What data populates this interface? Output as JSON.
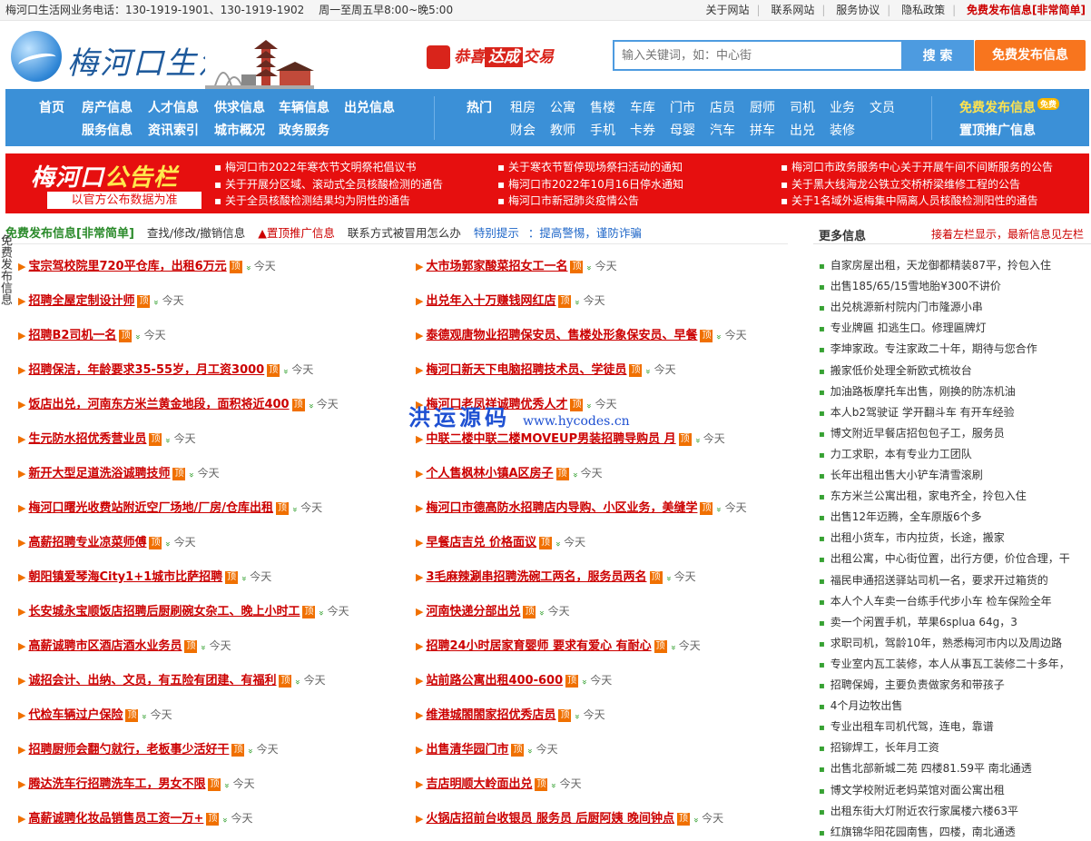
{
  "topbar": {
    "phone": "梅河口生活网业务电话：130-1919-1901、130-1919-1902",
    "hours": "周一至周五早8:00~晚5:00",
    "links": [
      "关于网站",
      "联系网站",
      "服务协议",
      "隐私政策"
    ],
    "free_publish": "免费发布信息[非常简单]"
  },
  "header": {
    "logo_text": "梅河口生活网",
    "promo_brand": "恭喜",
    "promo_box": "达成",
    "promo_tail": "交易",
    "search_placeholder": "输入关键词，如：中心街",
    "search_button": "搜 索",
    "publish_button": "免费发布信息"
  },
  "nav": {
    "main_row1": [
      "首页",
      "房产信息",
      "人才信息",
      "供求信息",
      "车辆信息",
      "出兑信息"
    ],
    "main_row2": [
      "服务信息",
      "资讯索引",
      "城市概况",
      "政务服务"
    ],
    "hot_label": "热门",
    "hot_row1": [
      "租房",
      "公寓",
      "售楼",
      "车库",
      "门市",
      "店员",
      "厨师",
      "司机",
      "业务",
      "文员"
    ],
    "hot_row2": [
      "财会",
      "教师",
      "手机",
      "卡券",
      "母婴",
      "汽车",
      "拼车",
      "出兑",
      "装修"
    ],
    "free_publish": "免费发布信息",
    "free_tag": "免费",
    "top_promo": "置顶推广信息"
  },
  "notice": {
    "title_big_a": "梅河口",
    "title_big_b": "公告栏",
    "title_small": "以官方公布数据为准",
    "col1": [
      "梅河口市2022年寒衣节文明祭祀倡议书",
      "关于开展分区域、滚动式全员核酸检测的通告",
      "关于全员核酸检测结果均为阴性的通告"
    ],
    "col2": [
      "关于寒衣节暂停现场祭扫活动的通知",
      "梅河口市2022年10月16日停水通知",
      "梅河口市新冠肺炎疫情公告"
    ],
    "col3": [
      "梅河口市政务服务中心关于开展午间不间断服务的公告",
      "关于黑大线海龙公铁立交桥桥梁维修工程的公告",
      "关于1名域外返梅集中隔离人员核酸检测阳性的通告"
    ]
  },
  "subbar": {
    "free": "免费发布信息[非常简单]",
    "manage": "查找/修改/撤销信息",
    "top": "▲置顶推广信息",
    "contact": "联系方式被冒用怎么办",
    "tip_label": "特别提示",
    "tip": "：提高警惕，谨防诈骗"
  },
  "side_deco": "免费发布信息",
  "listings": {
    "ding": "顶",
    "date": "今天",
    "left": [
      "宝宗驾校院里720平仓库，出租6万元",
      "招聘全屋定制设计师",
      "招聘B2司机一名",
      "招聘保洁，年龄要求35-55岁，月工资3000",
      "饭店出兑，河南东方米兰黄金地段，面积将近400",
      "生元防水招优秀营业员",
      "新开大型足道洗浴诚聘技师",
      "梅河口曙光收费站附近空厂场地/厂房/仓库出租",
      "高薪招聘专业凉菜师傅",
      "朝阳镇爱琴海City1+1城市比萨招聘",
      "长安城永宝顺饭店招聘后厨刷碗女杂工、晚上小时工",
      "高薪诚聘市区酒店酒水业务员",
      "诚招会计、出纳、文员，有五险有团建、有福利",
      "代检车辆过户保险",
      "招聘厨师会翻勺就行，老板事少活好干",
      "腾达洗车行招聘洗车工，男女不限",
      "高薪诚聘化妆品销售员工资一万+"
    ],
    "right": [
      "大市场郭家酸菜招女工一名",
      "出兑年入十万赚钱网红店",
      "泰德观唐物业招聘保安员、售楼处形象保安员、早餐",
      "梅河口新天下电脑招聘技术员、学徒员",
      "梅河口老凤祥诚聘优秀人才",
      "中联二楼中联二楼MOVEUP男装招聘导购员 月",
      "个人售枫林小镇A区房子",
      "梅河口市德高防水招聘店内导购、小区业务，美缝学",
      "早餐店吉兑 价格面议",
      "3毛麻辣涮串招聘洗碗工两名，服务员两名",
      "河南快递分部出兑",
      "招聘24小时居家育婴师 要求有爱心 有耐心",
      "站前路公寓出租400-600",
      "维港城閤閤家招优秀店员",
      "出售清华园门市",
      "吉店明顺大岭面出兑",
      "火锅店招前台收银员 服务员 后厨阿姨 晚间钟点"
    ]
  },
  "watermark": {
    "cn": "洪运源码",
    "url": "www.hycodes.cn"
  },
  "more": {
    "title": "更多信息",
    "note": "接着左栏显示，最新信息见左栏",
    "items": [
      "自家房屋出租，天龙御都精装87平，拎包入住",
      "出售185/65/15雪地胎¥300不讲价",
      "出兑桃源新村院内门市隆源小串",
      "专业牌匾 扣逃生口。修理匾牌灯",
      "李坤家政。专注家政二十年，期待与您合作",
      "搬家低价处理全新欧式梳妆台",
      "加油路板摩托车出售，刚换的防冻机油",
      "本人b2驾驶证 学开翻斗车 有开车经验",
      "博文附近早餐店招包包子工，服务员",
      "力工求职，本有专业力工团队",
      "长年出租出售大小铲车清雪滚刷",
      "东方米兰公寓出租，家电齐全，拎包入住",
      "出售12年迈腾，全车原版6个多",
      "出租小货车，市内拉货，长途，搬家",
      "出租公寓，中心街位置，出行方便，价位合理，干",
      "福民申通招送驿站司机一名，要求开过箱货的",
      "本人个人车卖一台练手代步小车 检车保险全年",
      "卖一个闲置手机，苹果6splua 64g，3",
      "求职司机，驾龄10年，熟悉梅河市内以及周边路",
      "专业室内瓦工装修，本人从事瓦工装修二十多年，",
      "招聘保姆，主要负责做家务和带孩子",
      "4个月边牧出售",
      "专业出租车司机代驾，连电，靠谱",
      "招铆焊工，长年月工资",
      "出售北部新城二苑 四楼81.59平 南北通透",
      "博文学校附近老妈菜馆对面公寓出租",
      "出租东街大灯附近农行家属楼六楼63平",
      "红旗锦华阳花园南售，四楼，南北通透"
    ]
  },
  "colors": {
    "nav_blue": "#3b90d7",
    "notice_red": "#e60f0f",
    "orange": "#f8751e",
    "title_red": "#cc0000",
    "green_arrow": "#37a233"
  }
}
